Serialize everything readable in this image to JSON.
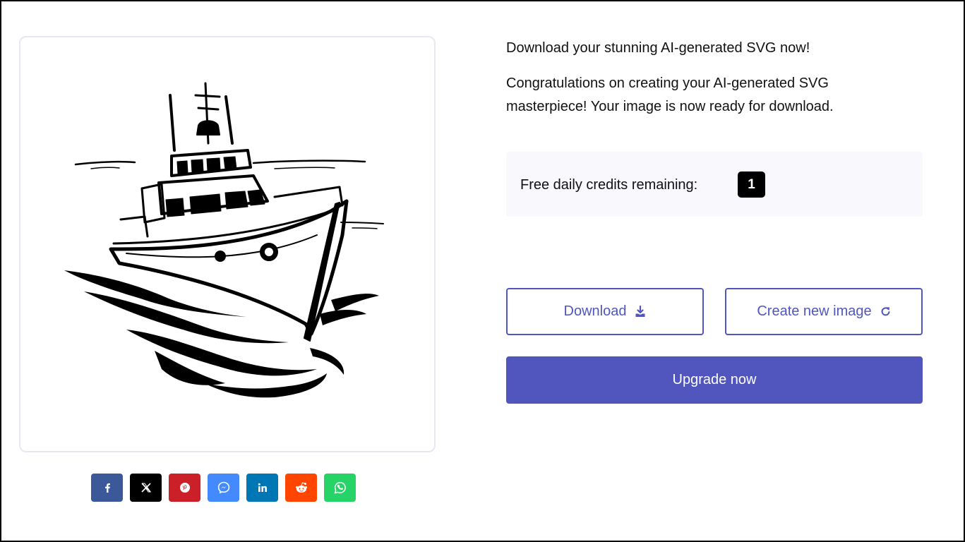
{
  "headline": "Download your stunning AI-generated SVG now!",
  "message": "Congratulations on creating your AI-generated SVG masterpiece! Your image is now ready for download.",
  "credits": {
    "label": "Free daily credits remaining:",
    "value": "1"
  },
  "buttons": {
    "download": "Download",
    "download_icon": "download-icon",
    "create_new": "Create new image",
    "create_icon": "refresh-icon",
    "upgrade": "Upgrade now"
  },
  "image": {
    "subject": "boat-illustration"
  },
  "share": [
    {
      "network": "facebook",
      "icon": "facebook-icon",
      "color": "#3b5998"
    },
    {
      "network": "x",
      "icon": "x-icon",
      "color": "#000000"
    },
    {
      "network": "pinterest",
      "icon": "pinterest-icon",
      "color": "#cb2027"
    },
    {
      "network": "messenger",
      "icon": "messenger-icon",
      "color": "#448aff"
    },
    {
      "network": "linkedin",
      "icon": "linkedin-icon",
      "color": "#0077b5"
    },
    {
      "network": "reddit",
      "icon": "reddit-icon",
      "color": "#ff4500"
    },
    {
      "network": "whatsapp",
      "icon": "whatsapp-icon",
      "color": "#25d366"
    }
  ],
  "colors": {
    "accent": "#5156be",
    "credits_bg": "#f8f8fd",
    "card_border": "#e6e8f3"
  }
}
